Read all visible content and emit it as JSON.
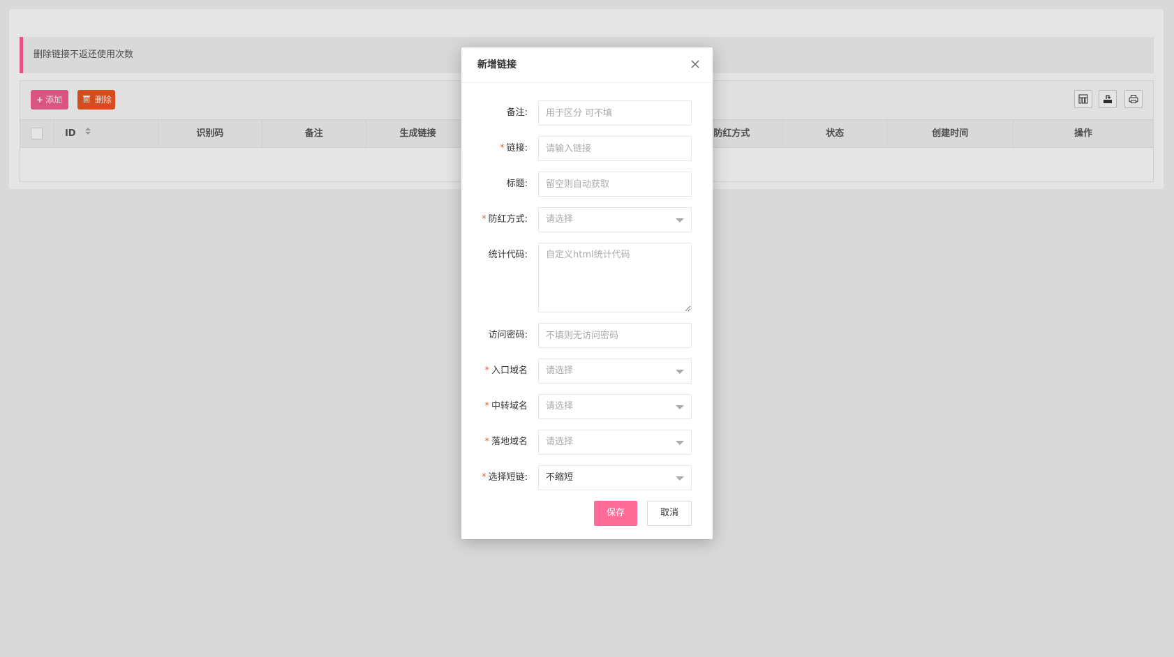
{
  "notice": "删除链接不返还使用次数",
  "toolbar": {
    "add_label": "添加",
    "delete_label": "删除",
    "right_icons": [
      "columns-icon",
      "export-icon",
      "print-icon"
    ]
  },
  "table": {
    "columns": [
      "ID",
      "识别码",
      "备注",
      "生成链接",
      "防红方式",
      "状态",
      "创建时间",
      "操作"
    ]
  },
  "modal": {
    "title": "新增链接",
    "fields": {
      "remark": {
        "label": "备注:",
        "placeholder": "用于区分 可不填"
      },
      "link": {
        "label": "链接:",
        "placeholder": "请输入链接"
      },
      "title": {
        "label": "标题:",
        "placeholder": "留空则自动获取"
      },
      "protect": {
        "label": "防红方式:",
        "placeholder": "请选择"
      },
      "stats_code": {
        "label": "统计代码:",
        "placeholder": "自定义html统计代码"
      },
      "password": {
        "label": "访问密码:",
        "placeholder": "不填则无访问密码"
      },
      "entry_domain": {
        "label": "入口域名",
        "placeholder": "请选择"
      },
      "relay_domain": {
        "label": "中转域名",
        "placeholder": "请选择"
      },
      "landing_domain": {
        "label": "落地域名",
        "placeholder": "请选择"
      },
      "short_link": {
        "label": "选择短链:",
        "value": "不缩短"
      }
    },
    "save_label": "保存",
    "cancel_label": "取消"
  },
  "colors": {
    "accent_pink": "#ff6c98",
    "delete_orange": "#ee5521",
    "required_red": "#ff5722"
  }
}
